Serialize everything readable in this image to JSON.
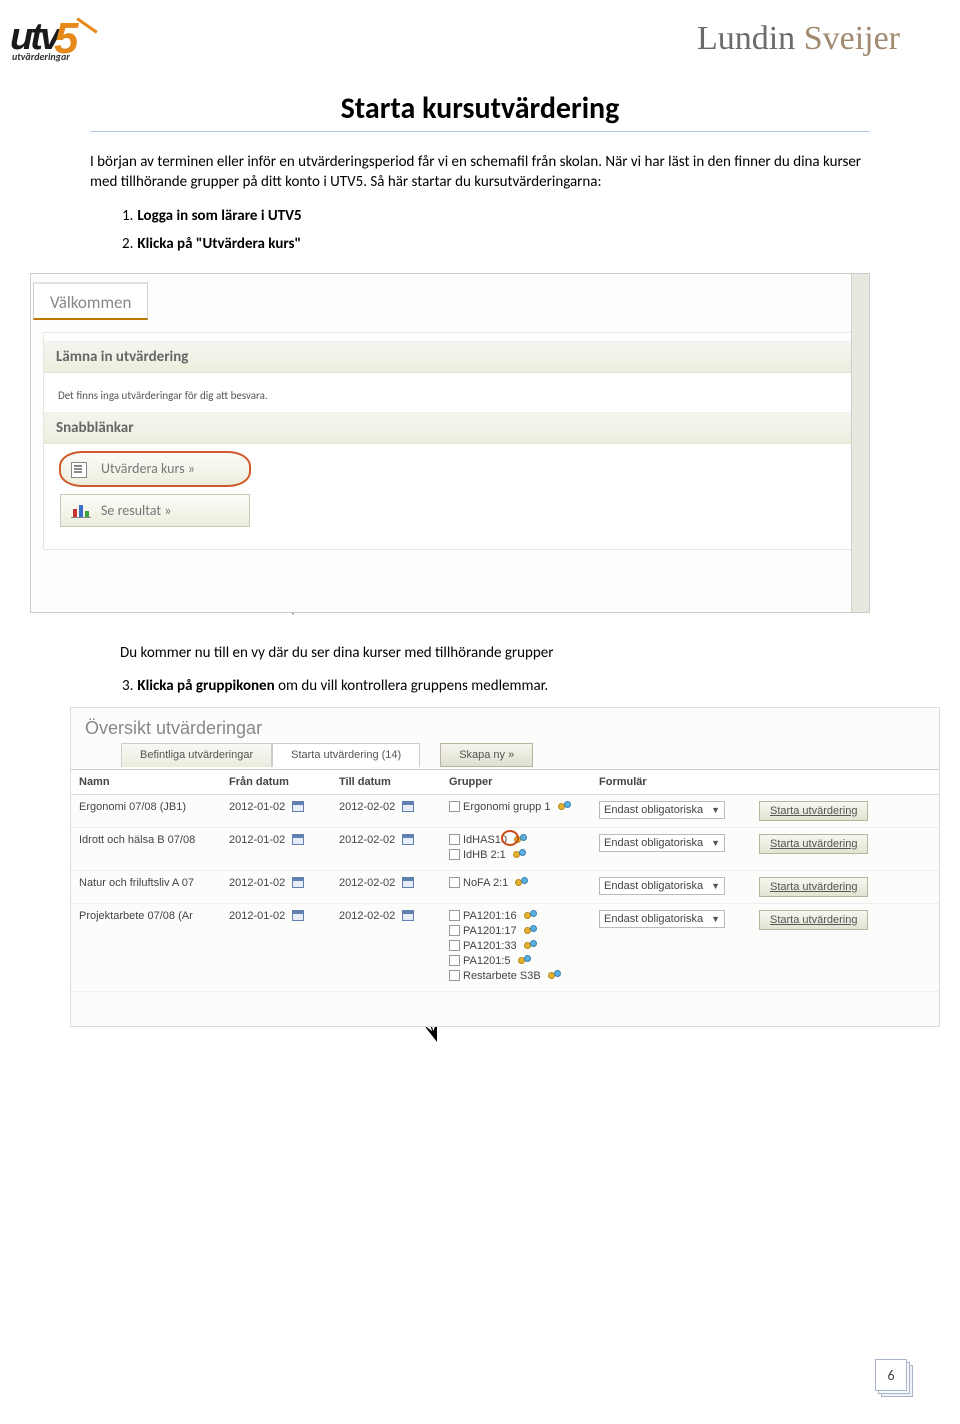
{
  "header": {
    "logo_left_main": "utv",
    "logo_left_num": "5",
    "logo_left_sub": "utvärderingar",
    "logo_right_1": "Lundin ",
    "logo_right_2": "Sveijer"
  },
  "title": "Starta kursutvärdering",
  "intro": "I början av terminen eller inför en utvärderingsperiod får vi en schemafil från skolan. När vi har läst in den finner du dina kurser med tillhörande grupper på ditt konto i UTV5. Så här startar du kursutvärderingarna:",
  "steps": {
    "s1_num": "1.",
    "s1": "Logga in som lärare i UTV5",
    "s2_num": "2.",
    "s2": "Klicka på \"Utvärdera kurs\""
  },
  "ss1": {
    "tab": "Välkommen",
    "sec1": "Lämna in utvärdering",
    "note": "Det finns inga utvärderingar för dig att besvara.",
    "sec2": "Snabblänkar",
    "btn1": "Utvärdera kurs »",
    "btn2": "Se resultat »"
  },
  "mid_text": "Du kommer nu till en vy där du ser dina kurser med tillhörande grupper",
  "step3_num": "3.",
  "step3_bold": "Klicka på gruppikonen",
  "step3_rest": " om du vill kontrollera gruppens medlemmar.",
  "ss2": {
    "title": "Översikt utvärderingar",
    "tab1": "Befintliga utvärderingar",
    "tab2": "Starta utvärdering (14)",
    "tab3": "Skapa ny »",
    "cols": {
      "c1": "Namn",
      "c2": "Från datum",
      "c3": "Till datum",
      "c4": "Grupper",
      "c5": "Formulär",
      "c6": ""
    },
    "rows": [
      {
        "name": "Ergonomi 07/08 (JB1)",
        "from": "2012-01-02",
        "to": "2012-02-02",
        "groups": [
          "Ergonomi grupp 1"
        ],
        "form": "Endast obligatoriska",
        "action": "Starta utvärdering"
      },
      {
        "name": "Idrott och hälsa B 07/08",
        "from": "2012-01-02",
        "to": "2012-02-02",
        "groups": [
          "IdHAS10",
          "IdHB 2:1"
        ],
        "form": "Endast obligatoriska",
        "action": "Starta utvärdering"
      },
      {
        "name": "Natur och friluftsliv A 07",
        "from": "2012-01-02",
        "to": "2012-02-02",
        "groups": [
          "NoFA 2:1"
        ],
        "form": "Endast obligatoriska",
        "action": "Starta utvärdering"
      },
      {
        "name": "Projektarbete 07/08 (Ar",
        "from": "2012-01-02",
        "to": "2012-02-02",
        "groups": [
          "PA1201:16",
          "PA1201:17",
          "PA1201:33",
          "PA1201:5",
          "Restarbete S3B"
        ],
        "form": "Endast obligatoriska",
        "action": "Starta utvärdering"
      }
    ]
  },
  "page_number": "6"
}
